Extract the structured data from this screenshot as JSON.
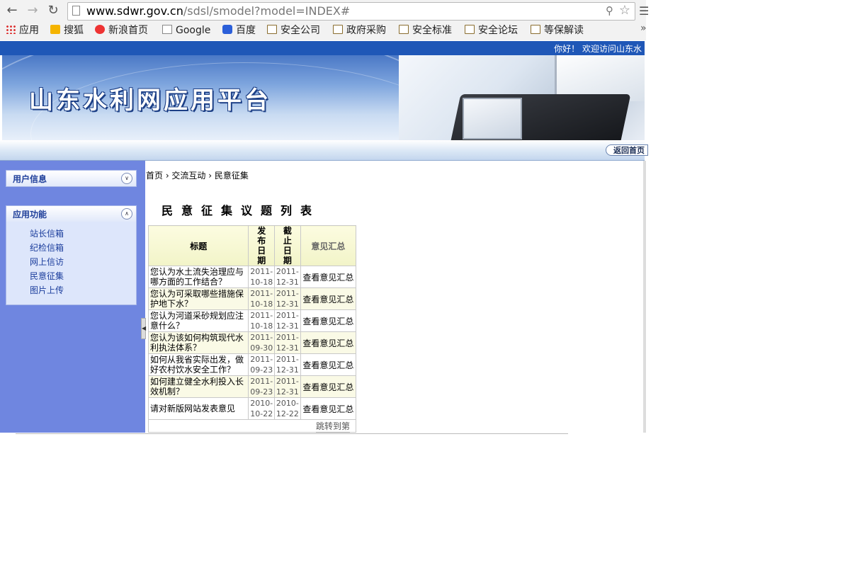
{
  "browser": {
    "url_host": "www.sdwr.gov.cn",
    "url_path": "/sdsl/smodel?model=INDEX#",
    "back_icon": "arrow-left-icon",
    "forward_icon": "arrow-right-icon",
    "reload_icon": "reload-icon",
    "bookmarks": [
      {
        "label": "应用",
        "icon": "apps-icon"
      },
      {
        "label": "搜狐",
        "icon": "sohu-icon"
      },
      {
        "label": "新浪首页",
        "icon": "sina-icon"
      },
      {
        "label": "Google",
        "icon": "page-icon"
      },
      {
        "label": "百度",
        "icon": "baidu-icon"
      },
      {
        "label": "安全公司",
        "icon": "folder-icon"
      },
      {
        "label": "政府采购",
        "icon": "folder-icon"
      },
      {
        "label": "安全标准",
        "icon": "folder-icon"
      },
      {
        "label": "安全论坛",
        "icon": "folder-icon"
      },
      {
        "label": "等保解读",
        "icon": "folder-icon"
      }
    ]
  },
  "page": {
    "welcome": "你好！ 欢迎访问山东水",
    "banner_title": "山东水利网应用平台",
    "home_button": "返回首页",
    "sidebar": {
      "user_panel": "用户信息",
      "app_panel": "应用功能",
      "app_items": [
        "站长信箱",
        "纪检信箱",
        "网上信访",
        "民意征集",
        "图片上传"
      ]
    },
    "breadcrumb": "首页 › 交流互动 › 民意征集",
    "list_title": "民意征集议题列表",
    "table": {
      "headers": {
        "title": "标题",
        "publish": "发布日期",
        "deadline": "截止日期",
        "summary": "意见汇总"
      },
      "rows": [
        {
          "title": "您认为水土流失治理应与哪方面的工作结合？",
          "publish": "2011-10-18",
          "deadline": "2011-12-31",
          "link": "查看意见汇总"
        },
        {
          "title": "您认为可采取哪些措施保护地下水？",
          "publish": "2011-10-18",
          "deadline": "2011-12-31",
          "link": "查看意见汇总"
        },
        {
          "title": "您认为河道采砂规划应注意什么？",
          "publish": "2011-10-18",
          "deadline": "2011-12-31",
          "link": "查看意见汇总"
        },
        {
          "title": "您认为该如何构筑现代水利执法体系？",
          "publish": "2011-09-30",
          "deadline": "2011-12-31",
          "link": "查看意见汇总"
        },
        {
          "title": "如何从我省实际出发，做好农村饮水安全工作？",
          "publish": "2011-09-23",
          "deadline": "2011-12-31",
          "link": "查看意见汇总"
        },
        {
          "title": "如何建立健全水利投入长效机制？",
          "publish": "2011-09-23",
          "deadline": "2011-12-31",
          "link": "查看意见汇总"
        },
        {
          "title": "请对新版网站发表意见",
          "publish": "2010-10-22",
          "deadline": "2010-12-22",
          "link": "查看意见汇总"
        }
      ],
      "pager": "跳转到第"
    }
  }
}
